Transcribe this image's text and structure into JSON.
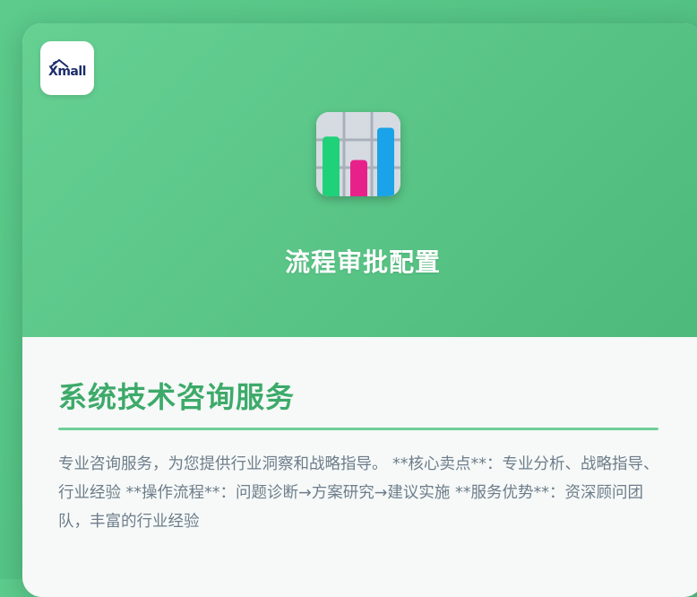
{
  "brand": {
    "logo_text": "Xmall"
  },
  "hero": {
    "title": "流程审批配置",
    "icon": "bar-chart-icon",
    "bar_colors": [
      "#1fd27a",
      "#e8218a",
      "#1aa3e8"
    ],
    "bar_levels": [
      0.74,
      0.45,
      0.85
    ]
  },
  "content": {
    "title": "系统技术咨询服务",
    "description": "专业咨询服务，为您提供行业洞察和战略指导。 **核心卖点**：专业分析、战略指导、行业经验 **操作流程**：问题诊断→方案研究→建议实施 **服务优势**：资深顾问团队，丰富的行业经验"
  },
  "colors": {
    "accent": "#3daa6a",
    "hero_bg": "#5cc888",
    "divider": "#6fcf98"
  }
}
